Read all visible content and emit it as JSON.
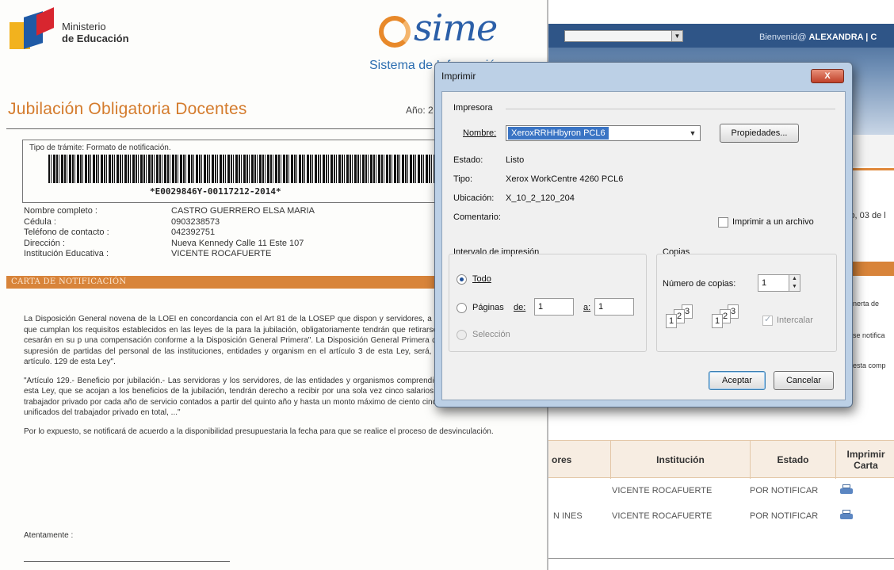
{
  "document": {
    "logo_line1": "Ministerio",
    "logo_line2": "de Educación",
    "sime_brand": "sime",
    "sime_subtitle": "Sistema de Información",
    "title": "Jubilación Obligatoria Docentes",
    "year_label": "Año: 2",
    "tramite_label": "Tipo de trámite: Formato de notificación.",
    "barcode_number": "*E0029846Y-00117212-2014*",
    "fields": [
      {
        "label": "Nombre completo :",
        "value": "CASTRO GUERRERO ELSA MARIA"
      },
      {
        "label": "Cédula :",
        "value": "0903238573"
      },
      {
        "label": "Teléfono de contacto :",
        "value": "042392751"
      },
      {
        "label": "Dirección :",
        "value": "Nueva Kennedy Calle 11 Este 107"
      },
      {
        "label": "Institución Educativa :",
        "value": "VICENTE ROCAFUERTE"
      }
    ],
    "section_banner": "CARTA DE NOTIFICACIÓN",
    "paragraph1": "La Disposición General novena de la LOEI en concordancia con el Art 81 de la LOSEP que dispon y servidores, a los (70 años) de edad, que cumplan los requisitos establecidos en las leyes de la para la jubilación, obligatoriamente tendrán que retirarse del servicio público y cesarán en su p una compensación conforme a la Disposición General Primera\". La Disposición General Primera d la indemnización, por supresión de partidas del personal de las instituciones, entidades y organism en el artículo 3 de esta Ley, será, igual al indicado en el artículo. 129 de esta Ley\".",
    "paragraph2": "\"Artículo 129.- Beneficio por jubilación.- Las servidoras y los servidores, de las entidades y organismos comprendidos en el artículo 3 de esta Ley, que se acojan a los beneficios de la jubilación, tendrán derecho a recibir por una sola vez cinco salarios básicos unificados del trabajador privado por cada año de servicio contados a partir del quinto año y hasta un monto máximo de ciento cincuenta salarios básicos unificados del trabajador privado en total, ...\"",
    "paragraph3": "Por lo expuesto, se notificará de acuerdo a la disponibilidad presupuestaria la fecha para que se realice el proceso de desvinculación.",
    "closing": "Atentamente :"
  },
  "app": {
    "welcome_prefix": "Bienvenid@",
    "welcome_user": "ALEXANDRA | C",
    "date_fragment": "lo, 03 de l",
    "side_text": [
      "nerta de",
      "se notifica",
      "esta comp"
    ],
    "table": {
      "headers": [
        "ores",
        "Institución",
        "Estado",
        "Imprimir Carta"
      ],
      "rows": [
        {
          "name": "",
          "institucion": "VICENTE ROCAFUERTE",
          "estado": "POR NOTIFICAR"
        },
        {
          "name": "N INES",
          "institucion": "VICENTE ROCAFUERTE",
          "estado": "POR NOTIFICAR"
        }
      ]
    }
  },
  "print_dialog": {
    "title": "Imprimir",
    "close_label": "X",
    "printer_group": "Impresora",
    "name_label": "Nombre:",
    "printer_name": "XeroxRRHHbyron PCL6",
    "properties_button": "Propiedades...",
    "status_label": "Estado:",
    "status_value": "Listo",
    "type_label": "Tipo:",
    "type_value": "Xerox WorkCentre 4260 PCL6",
    "location_label": "Ubicación:",
    "location_value": "X_10_2_120_204",
    "comment_label": "Comentario:",
    "print_to_file_label": "Imprimir a un archivo",
    "range_group": "Intervalo de impresión",
    "range_all": "Todo",
    "range_pages": "Páginas",
    "from_label": "de:",
    "from_value": "1",
    "to_label": "a:",
    "to_value": "1",
    "range_selection": "Selección",
    "copies_group": "Copias",
    "copies_label": "Número de copias:",
    "copies_value": "1",
    "collate_label": "Intercalar",
    "ok_button": "Aceptar",
    "cancel_button": "Cancelar"
  }
}
